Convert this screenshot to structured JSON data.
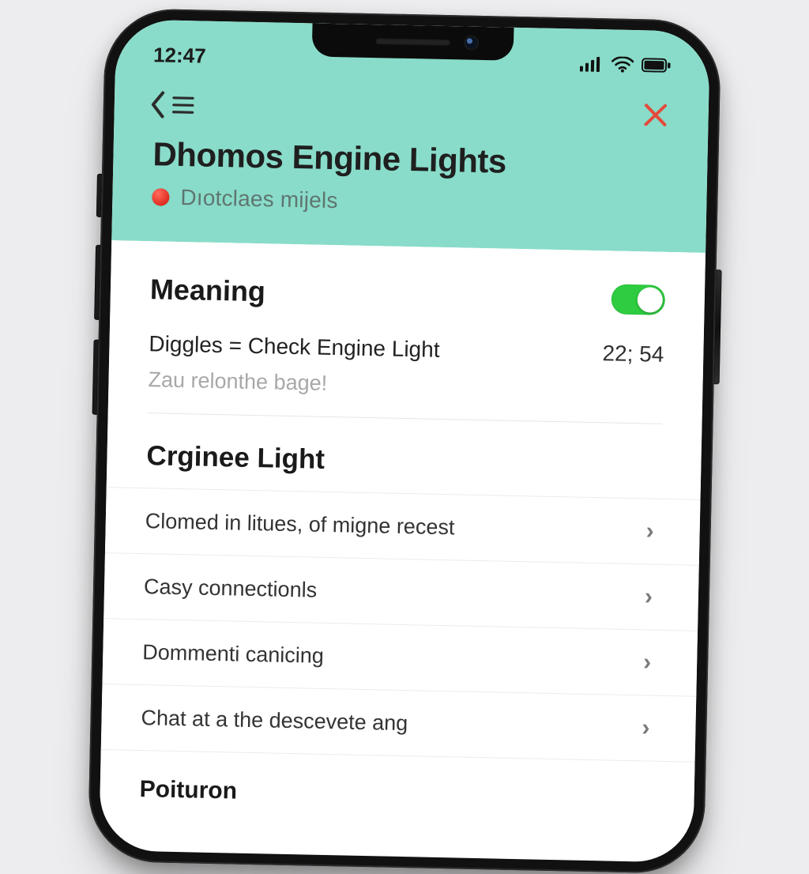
{
  "statusbar": {
    "time": "12:47"
  },
  "header": {
    "title": "Dhomos Engine Lights",
    "subtitle": "Dıotclaes mijels"
  },
  "meaning": {
    "heading": "Meaning",
    "toggle_on": true,
    "row_label": "Diggles = Check Engine Light",
    "row_value": "22; 54",
    "hint": "Zau relonthe bage!"
  },
  "crginee": {
    "heading": "Crginee Light",
    "items": [
      {
        "label": "Clomed in litues, of migne recest"
      },
      {
        "label": "Casy connectionls"
      },
      {
        "label": "Dommenti canicing"
      },
      {
        "label": "Chat at a the descevete ang"
      }
    ]
  },
  "footer": {
    "heading": "Poituron"
  }
}
